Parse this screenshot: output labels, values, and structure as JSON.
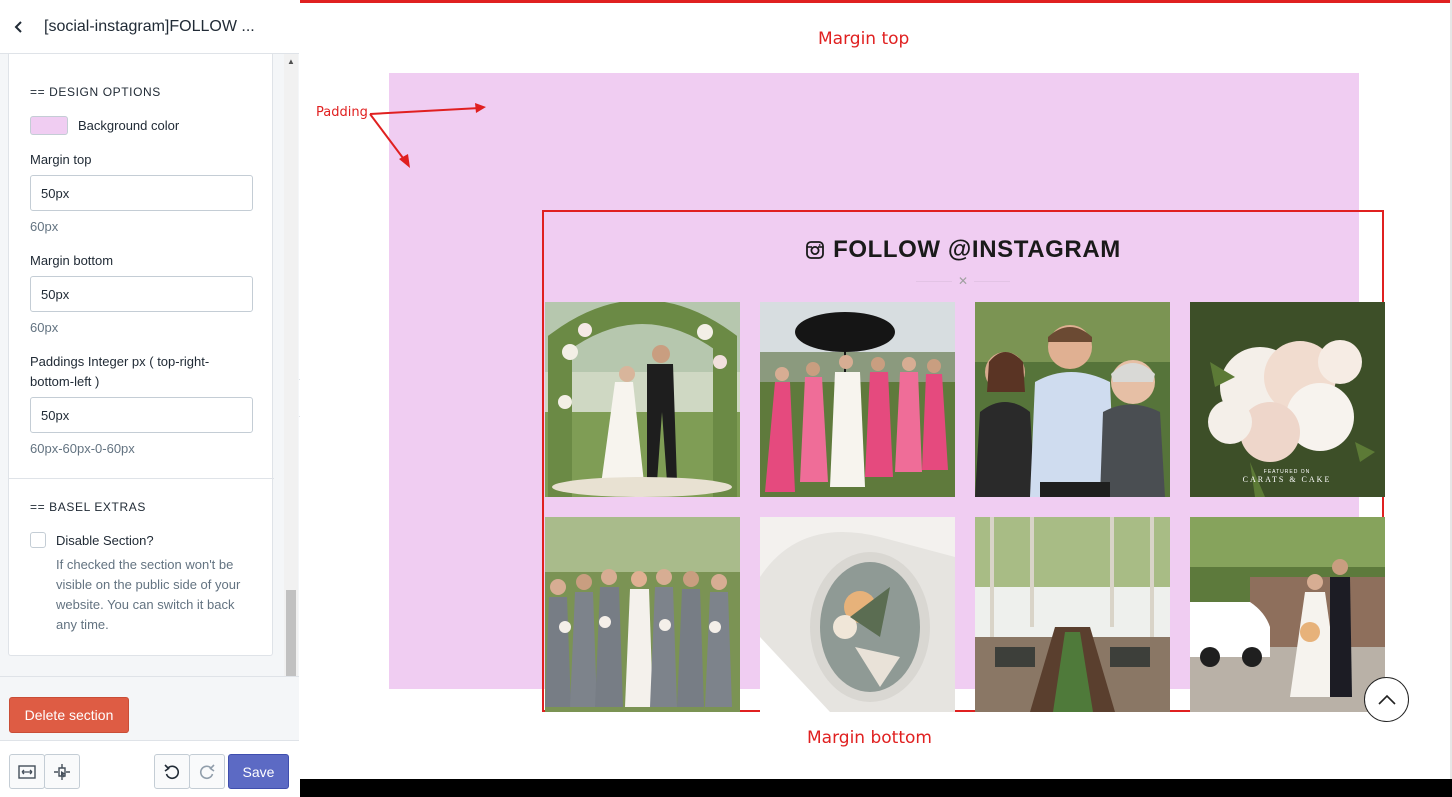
{
  "sidebar": {
    "title": "[social-instagram]FOLLOW ...",
    "design_options": {
      "heading": "== DESIGN OPTIONS",
      "bg_color_label": "Background color",
      "bg_color": "#f0cdf2",
      "margin_top": {
        "label": "Margin top",
        "value": "50px",
        "hint": "60px"
      },
      "margin_bottom": {
        "label": "Margin bottom",
        "value": "50px",
        "hint": "60px"
      },
      "paddings": {
        "label": "Paddings Integer px ( top-right-bottom-left )",
        "value": "50px",
        "hint": "60px-60px-0-60px"
      }
    },
    "basel_extras": {
      "heading": "== BASEL EXTRAS",
      "disable_label": "Disable Section?",
      "disable_checked": false,
      "disable_help": "If checked the section won't be visible on the public side of your website. You can switch it back any time."
    },
    "delete_label": "Delete section",
    "save_label": "Save"
  },
  "preview": {
    "annotations": {
      "margin_top": "Margin top",
      "margin_bottom": "Margin bottom",
      "padding": "Padding"
    },
    "instagram_title": "FOLLOW @INSTAGRAM",
    "tile_badge": {
      "small": "FEATURED ON",
      "large": "CARATS & CAKE"
    }
  },
  "colors": {
    "accent": "#5c6ac4",
    "danger": "#de5c44",
    "annotation": "#e02020",
    "section_bg": "#f0cdf2"
  }
}
